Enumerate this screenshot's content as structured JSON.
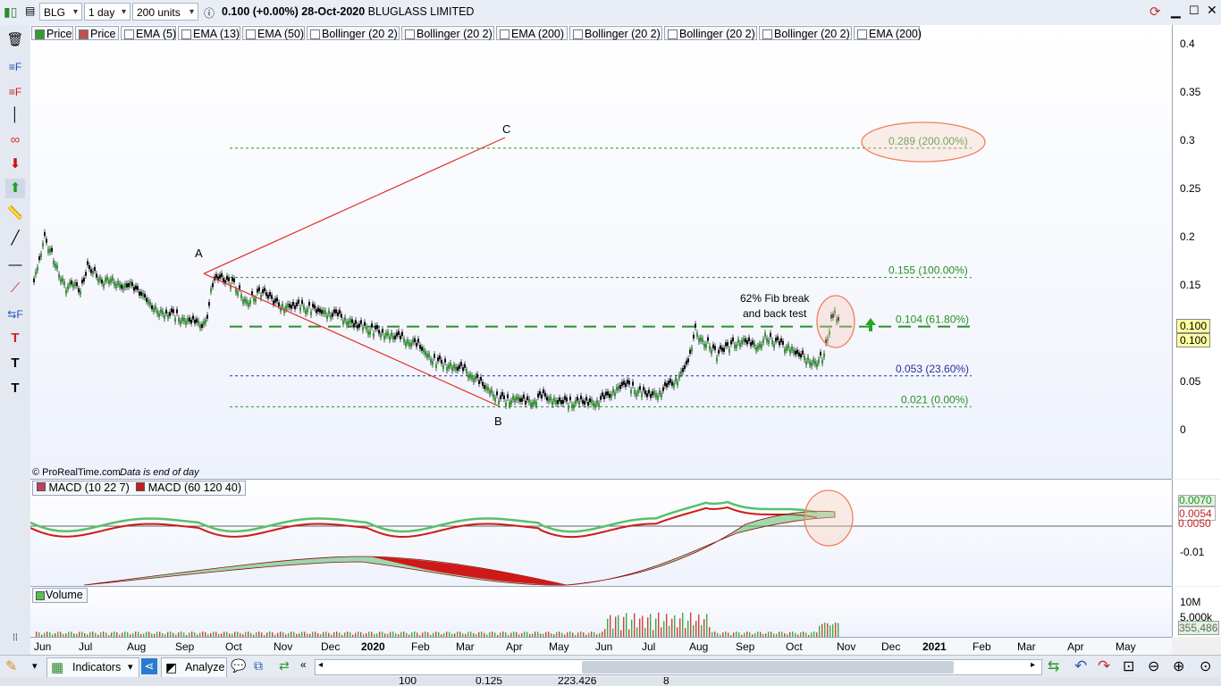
{
  "toolbar": {
    "symbol": "BLG",
    "timeframe": "1 day",
    "units": "200 units",
    "price_line": "0.100 (+0.00%) 28-Oct-2020",
    "company": "BLUGLASS LIMITED"
  },
  "indicator_tags": [
    "Price",
    "Price",
    "EMA (5)",
    "EMA (13)",
    "EMA (50)",
    "Bollinger (20 2)",
    "Bollinger (20 2)",
    "EMA (200)",
    "Bollinger (20 2)",
    "Bollinger (20 2)",
    "Bollinger (20 2)",
    "EMA (200)"
  ],
  "left_tools": [
    "trash-icon",
    "fib-retracement-icon",
    "fib-fan-icon",
    "vertical-line-icon",
    "channel-icon",
    "down-arrow-icon",
    "up-arrow-icon",
    "ruler-icon",
    "trend-line-icon",
    "horizontal-line-icon",
    "line-point-icon",
    "fib-projection-icon",
    "text-red-icon",
    "text-black-icon",
    "text-black-2-icon"
  ],
  "main_axis": {
    "ticks": [
      "0.4",
      "0.35",
      "0.3",
      "0.25",
      "0.2",
      "0.15",
      "0.1",
      "0.05",
      "0"
    ],
    "last_price_a": "0.100",
    "last_price_b": "0.100"
  },
  "chart_labels": {
    "point_a": "A",
    "point_b": "B",
    "point_c": "C",
    "fib_200": "0.289 (200.00%)",
    "fib_100": "0.155 (100.00%)",
    "fib_618": "0.104 (61.80%)",
    "fib_236": "0.053 (23.60%)",
    "fib_0": "0.021 (0.00%)",
    "annotation_line1": "62% Fib break",
    "annotation_line2": "and back test",
    "credit": "© ProRealTime.com",
    "data_note": "Data is end of day"
  },
  "macd": {
    "tag1": "MACD (10 22 7)",
    "tag2": "MACD (60 120 40)",
    "axis_ticks": [
      "-0.01"
    ],
    "value_top": "0.0070",
    "value_mid": "0.0054",
    "value_low": "0.0050"
  },
  "volume": {
    "tag": "Volume",
    "axis_ticks": [
      "10M",
      "5,000k"
    ],
    "last_value": "355,486"
  },
  "time_axis": [
    "Jun",
    "Jul",
    "Aug",
    "Sep",
    "Oct",
    "Nov",
    "Dec",
    "2020",
    "Feb",
    "Mar",
    "Apr",
    "May",
    "Jun",
    "Jul",
    "Aug",
    "Sep",
    "Oct",
    "Nov",
    "Dec",
    "2021",
    "Feb",
    "Mar",
    "Apr",
    "May"
  ],
  "bottombar": {
    "indicators_label": "Indicators",
    "analyze_label": "Analyze"
  },
  "strip_values": [
    "100",
    "0.125",
    "223.426",
    "8"
  ],
  "colors": {
    "up_candle": "#2e9e2e",
    "down_candle": "#111111",
    "abc_line": "#e0302a",
    "fib_line": "#2a8f2a",
    "fib_blue": "#2b2f9c",
    "highlight": "#f08060",
    "macd_green": "#58c06a",
    "macd_red": "#d01818"
  }
}
